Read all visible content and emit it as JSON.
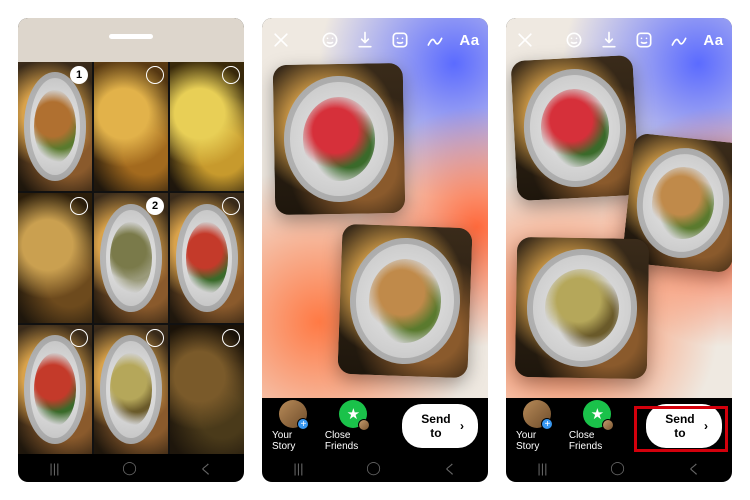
{
  "screens": {
    "gallery": {
      "selection_order": [
        "1",
        "2"
      ]
    },
    "editor": {
      "your_story_label": "Your Story",
      "close_friends_label": "Close Friends",
      "send_to_label": "Send to",
      "text_tool_label": "Aa"
    }
  },
  "android_nav": {
    "recent": "|||",
    "home": "◯",
    "back": "く"
  },
  "icons": {
    "close": "close-icon",
    "effects": "effects-icon",
    "save": "save-icon",
    "sticker": "sticker-icon",
    "draw": "draw-icon",
    "text": "text-icon",
    "chevron": "›"
  },
  "colors": {
    "send_button_bg": "#ffffff",
    "close_friends_green": "#1ac24a",
    "highlight_red": "#d3000c"
  }
}
